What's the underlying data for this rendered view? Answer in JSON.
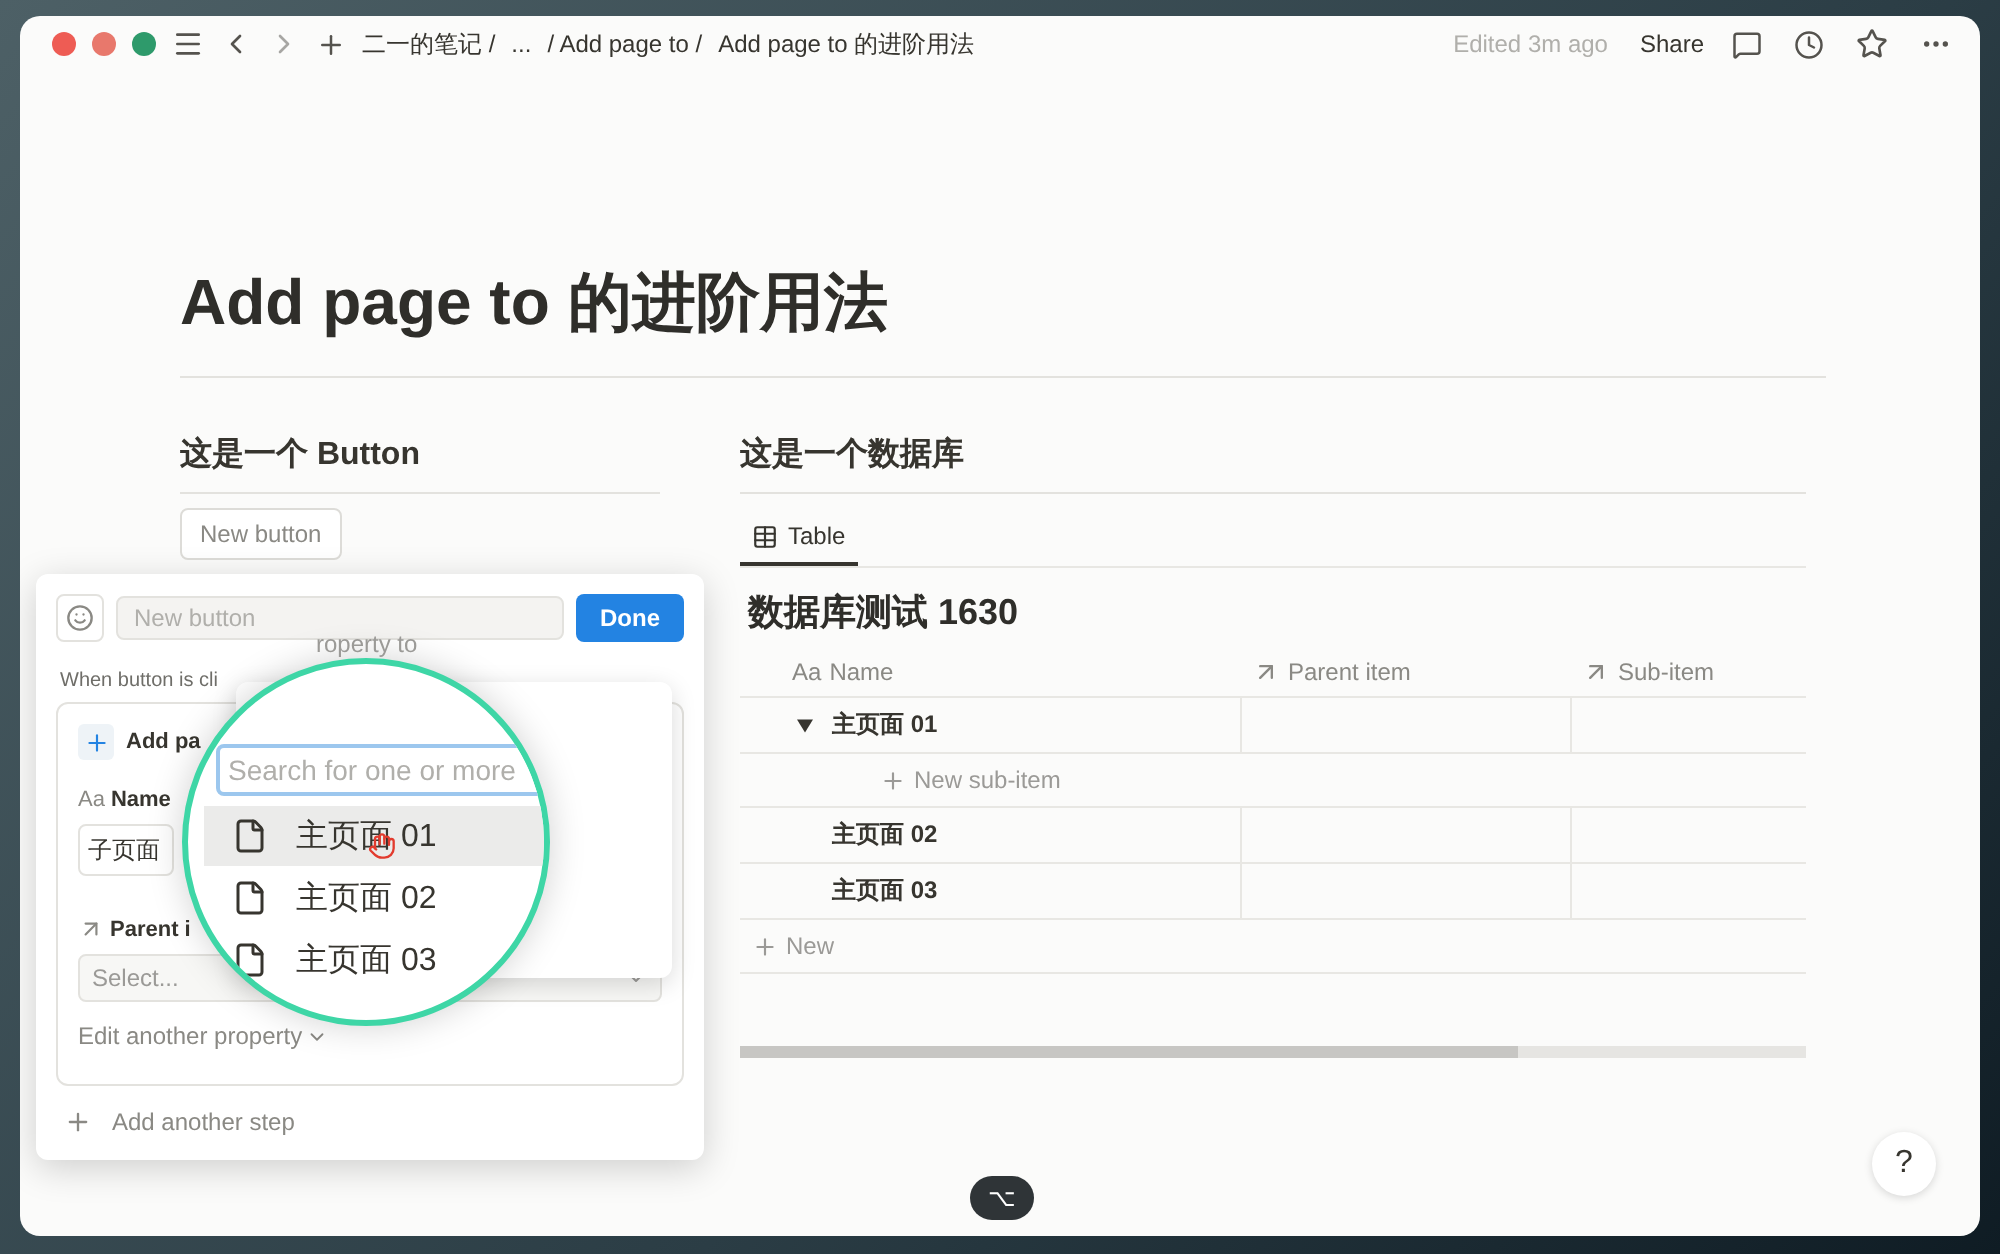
{
  "titlebar": {
    "breadcrumbs": [
      "二一的笔记 /",
      "...",
      "/ Add page to /",
      "Add page to 的进阶用法"
    ],
    "edited": "Edited 3m ago",
    "share": "Share"
  },
  "page": {
    "title": "Add page to 的进阶用法"
  },
  "left": {
    "heading": "这是一个 Button",
    "button": "New button"
  },
  "right": {
    "heading": "这是一个数据库",
    "tabs": [
      {
        "label": "Table",
        "selected": true
      }
    ],
    "db_title": "数据库测试 1630",
    "columns": [
      {
        "prefix": "Aa",
        "label": "Name",
        "kind": "text"
      },
      {
        "label": "Parent item",
        "kind": "relation"
      },
      {
        "label": "Sub-item",
        "kind": "relation"
      }
    ],
    "rows": [
      {
        "name": "主页面 01",
        "expanded": true,
        "sub_action": "New sub-item"
      },
      {
        "name": "主页面 02"
      },
      {
        "name": "主页面 03"
      }
    ],
    "new_row": "New"
  },
  "editor": {
    "name_placeholder": "New button",
    "done": "Done",
    "trigger": "When button is cli",
    "step": {
      "action": "Add pa",
      "name_prefix": "Aa",
      "name_label": "Name",
      "name_value": "子页面",
      "parent_label": "Parent i",
      "parent_placeholder": "Select...",
      "edit_another": "Edit another property"
    },
    "add_step": "Add another step"
  },
  "magnifier": {
    "partial": "roperty to",
    "search_placeholder": "Search for one or more",
    "items": [
      {
        "label": "主页面 01",
        "selected": true
      },
      {
        "label": "主页面 02",
        "selected": false
      },
      {
        "label": "主页面 03",
        "selected": false
      }
    ]
  },
  "help": "?",
  "shortcut": "⌥"
}
